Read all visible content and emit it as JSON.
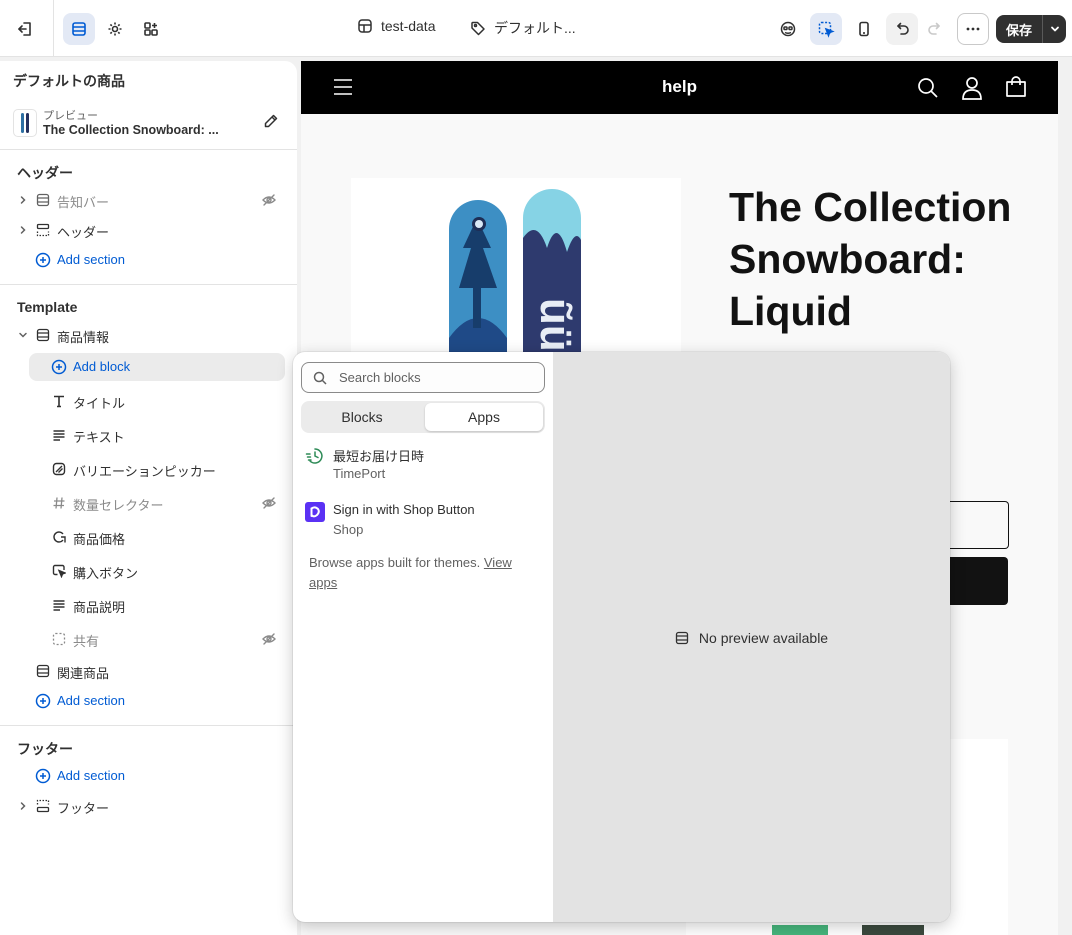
{
  "topbar": {
    "store_name": "test-data",
    "template_name": "デフォルト...",
    "save_label": "保存"
  },
  "sidebar": {
    "title": "デフォルトの商品",
    "preview_label": "プレビュー",
    "preview_product": "The Collection Snowboard: ...",
    "header_group": {
      "title": "ヘッダー",
      "items": [
        {
          "label": "告知バー",
          "hidden": true
        },
        {
          "label": "ヘッダー",
          "hidden": false
        }
      ],
      "add_section": "Add section"
    },
    "template_group": {
      "title": "Template",
      "section_label": "商品情報",
      "add_block": "Add block",
      "blocks": [
        {
          "label": "タイトル",
          "icon": "text-icon"
        },
        {
          "label": "テキスト",
          "icon": "paragraph-icon"
        },
        {
          "label": "バリエーションピッカー",
          "icon": "variant-icon"
        },
        {
          "label": "数量セレクター",
          "icon": "hash-icon",
          "hidden": true
        },
        {
          "label": "商品価格",
          "icon": "price-tag-icon"
        },
        {
          "label": "購入ボタン",
          "icon": "cursor-icon"
        },
        {
          "label": "商品説明",
          "icon": "paragraph-icon"
        },
        {
          "label": "共有",
          "icon": "share-icon",
          "hidden": true
        }
      ],
      "related_label": "関連商品",
      "add_section": "Add section"
    },
    "footer_group": {
      "title": "フッター",
      "add_section": "Add section",
      "items": [
        {
          "label": "フッター"
        }
      ]
    }
  },
  "store": {
    "brand": "help",
    "product_title": "The Collection Snowboard: Liquid"
  },
  "popover": {
    "search_placeholder": "Search blocks",
    "tabs": [
      "Blocks",
      "Apps"
    ],
    "active_tab": "Apps",
    "apps": [
      {
        "name": "最短お届け日時",
        "vendor": "TimePort",
        "icon": "timeport-icon"
      },
      {
        "name": "Sign in with Shop Button",
        "vendor": "Shop",
        "icon": "shop-icon"
      }
    ],
    "browse_text": "Browse apps built for themes.",
    "browse_link": "View apps",
    "no_preview": "No preview available"
  },
  "colors": {
    "accent": "#005bd3",
    "dark": "#303030",
    "shop_purple": "#5a31f4",
    "timeport_green": "#2e8b57"
  }
}
